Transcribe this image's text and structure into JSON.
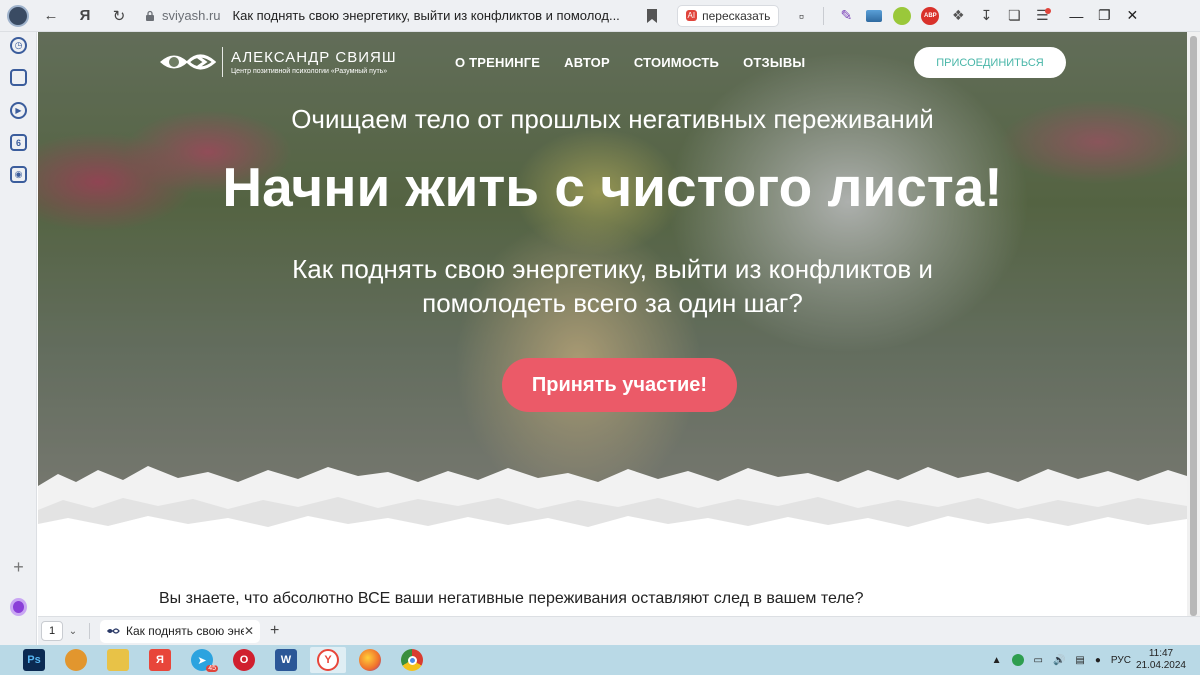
{
  "browser": {
    "domain": "sviyash.ru",
    "page_title": "Как поднять свою энергетику, выйти из конфликтов и помолод...",
    "retell_badge": "AI",
    "retell_label": "пересказать",
    "ext_abp_label": "ABP",
    "sidebar_badge": "6"
  },
  "site": {
    "logo_name": "АЛЕКСАНДР СВИЯШ",
    "logo_subtitle": "Центр позитивной психологии «Разумный путь»",
    "nav": [
      "О ТРЕНИНГЕ",
      "АВТОР",
      "СТОИМОСТЬ",
      "ОТЗЫВЫ"
    ],
    "join_label": "ПРИСОЕДИНИТЬСЯ",
    "kicker": "Очищаем тело от прошлых негативных переживаний",
    "headline": "Начни жить с чистого листа!",
    "question_line1": "Как поднять свою энергетику, выйти из конфликтов и",
    "question_line2": "помолодеть всего за один шаг?",
    "cta_label": "Принять участие!",
    "intro_text": "Вы знаете, что абсолютно ВСЕ ваши негативные переживания оставляют след в вашем теле?"
  },
  "tabs": {
    "count": "1",
    "active_tab_label": "Как поднять свою энер",
    "new_tab": "+"
  },
  "taskbar": {
    "apps": [
      {
        "name": "photoshop",
        "label": "Ps",
        "color": "#0b2a52"
      },
      {
        "name": "yandex-disk",
        "label": "",
        "color": "#e2962e"
      },
      {
        "name": "file-explorer",
        "label": "",
        "color": "#e8c247"
      },
      {
        "name": "yandex",
        "label": "Я",
        "color": "#e8463a"
      },
      {
        "name": "telegram",
        "label": "",
        "color": "#2ca3df"
      },
      {
        "name": "opera",
        "label": "O",
        "color": "#d01f2e"
      },
      {
        "name": "word",
        "label": "W",
        "color": "#2b5797"
      },
      {
        "name": "yandex-browser",
        "label": "Y",
        "color": "#ffffff"
      },
      {
        "name": "firefox",
        "label": "",
        "color": "#f0702c"
      },
      {
        "name": "chrome",
        "label": "",
        "color": "#3a8f3e"
      }
    ],
    "telegram_badge": "45",
    "language": "РУС",
    "time": "11:47",
    "date": "21.04.2024"
  },
  "colors": {
    "cta": "#eb5a68",
    "join_text": "#49b6a8",
    "taskbar": "#b9d9e6"
  }
}
